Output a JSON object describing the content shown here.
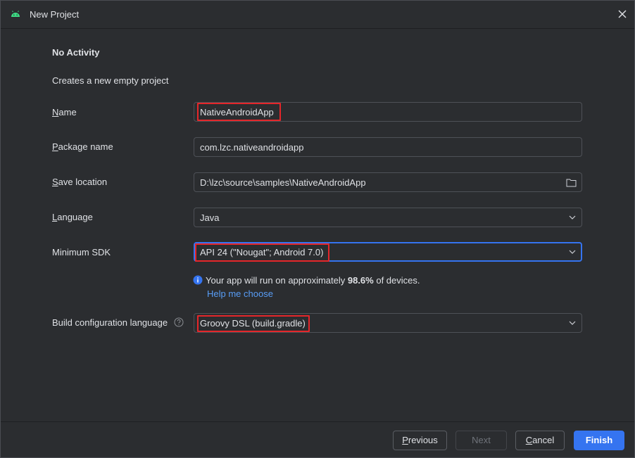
{
  "window": {
    "title": "New Project",
    "close_icon": "close-icon",
    "app_icon": "android-icon"
  },
  "template": {
    "heading": "No Activity",
    "description": "Creates a new empty project"
  },
  "form": {
    "name": {
      "mnemonic": "N",
      "label_rest": "ame",
      "value": "NativeAndroidApp"
    },
    "package": {
      "mnemonic": "P",
      "label_rest": "ackage name",
      "value": "com.lzc.nativeandroidapp"
    },
    "location": {
      "mnemonic": "S",
      "label_rest": "ave location",
      "value": "D:\\lzc\\source\\samples\\NativeAndroidApp"
    },
    "language": {
      "mnemonic": "L",
      "label_rest": "anguage",
      "value": "Java"
    },
    "min_sdk": {
      "label": "Minimum SDK",
      "value": "API 24 (\"Nougat\"; Android 7.0)"
    },
    "info": {
      "prefix": "Your app will run on approximately ",
      "percent": "98.6%",
      "suffix": " of devices."
    },
    "help_link": "Help me choose",
    "build_lang": {
      "label": "Build configuration language",
      "value": "Groovy DSL (build.gradle)"
    }
  },
  "buttons": {
    "previous": {
      "mnemonic": "P",
      "rest": "revious"
    },
    "next": "Next",
    "cancel": {
      "mnemonic": "C",
      "rest": "ancel"
    },
    "finish": "Finish"
  },
  "colors": {
    "accent": "#3574f0",
    "link": "#589df6",
    "highlight": "#e5262a",
    "background": "#2b2d30"
  }
}
